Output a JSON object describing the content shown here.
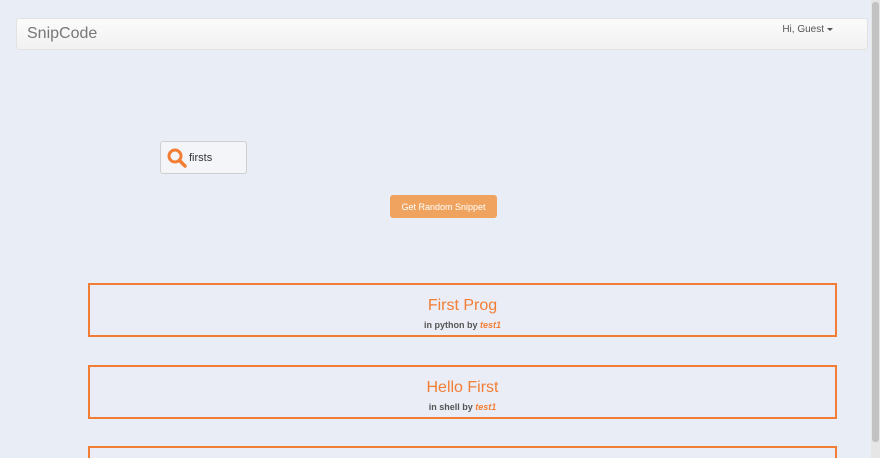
{
  "header": {
    "brand": "SnipCode",
    "user_menu": "Hi, Guest"
  },
  "search": {
    "value": "firsts",
    "icon": "search-icon"
  },
  "random_button": {
    "label": "Get Random Snippet"
  },
  "colors": {
    "accent": "#f27e36",
    "button": "#f0a35e",
    "background": "#e9edf5"
  },
  "snippets": [
    {
      "title": "First Prog",
      "lang_prefix": "in python by",
      "author": "test1"
    },
    {
      "title": "Hello First",
      "lang_prefix": "in shell by",
      "author": "test1"
    }
  ]
}
